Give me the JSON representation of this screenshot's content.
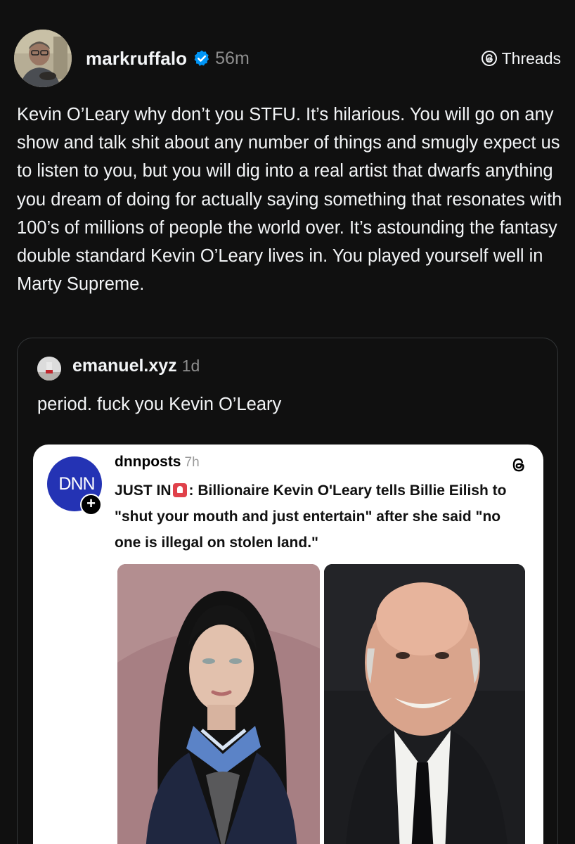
{
  "post": {
    "author": "markruffalo",
    "time": "56m",
    "platform_label": "Threads",
    "text": "Kevin O’Leary why don’t you STFU. It’s hilarious. You will go on any show and talk shit about any number of things and smugly expect us to listen to you, but you will dig into a real artist that dwarfs anything you dream of doing for actually saying something that resonates with 100’s of millions of people the world over.  It’s astounding the fantasy double standard Kevin O’Leary lives in. You played yourself well in Marty Supreme."
  },
  "quoted_post": {
    "author": "emanuel.xyz",
    "time": "1d",
    "text": "period. fuck you Kevin O’Leary"
  },
  "embedded_post": {
    "author": "dnnposts",
    "time": "7h",
    "avatar_text": "DNN",
    "text_prefix": "JUST IN",
    "text_rest": ": Billionaire Kevin O'Leary tells Billie Eilish to \"shut your mouth and just entertain\" after she said \"no one is illegal on stolen land.\""
  },
  "colors": {
    "background": "#101010",
    "text_primary": "#f3f5f7",
    "text_secondary": "#8e8e8e",
    "verified_badge": "#0095f6",
    "card_border": "#333638",
    "dnn_blue": "#2433b4",
    "siren_red": "#e0414a"
  },
  "icons": {
    "verified": "verified-badge-icon",
    "threads": "threads-logo-icon",
    "siren": "siren-emoji-icon",
    "follow": "plus-icon"
  }
}
